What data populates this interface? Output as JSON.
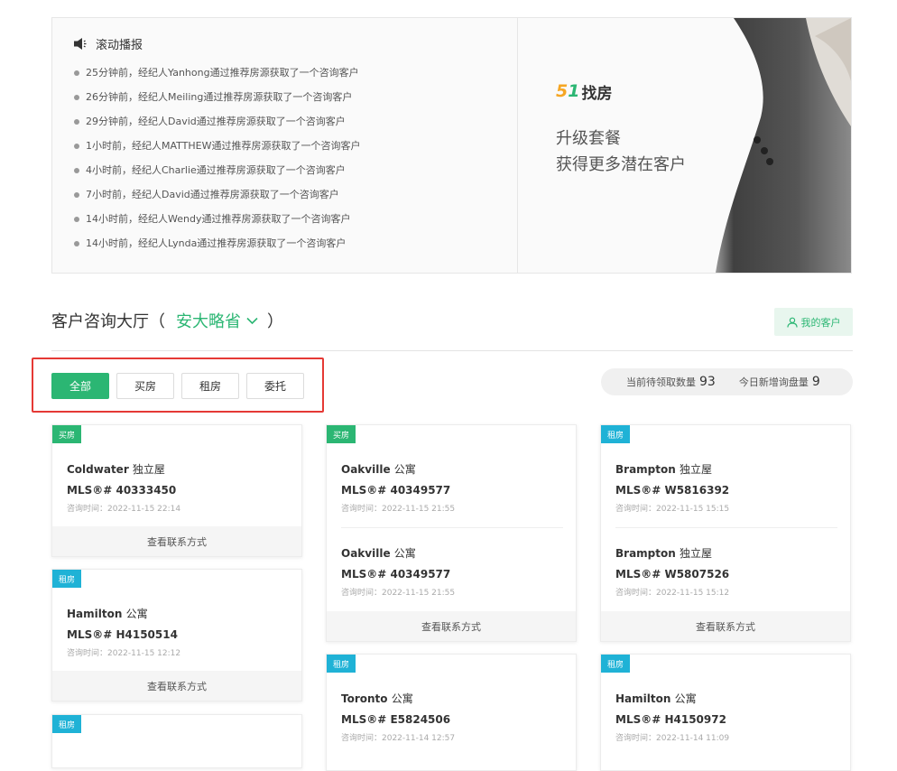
{
  "broadcast": {
    "title": "滚动播报",
    "items": [
      "25分钟前，经纪人Yanhong通过推荐房源获取了一个咨询客户",
      "26分钟前，经纪人Meiling通过推荐房源获取了一个咨询客户",
      "29分钟前，经纪人David通过推荐房源获取了一个咨询客户",
      "1小时前，经纪人MATTHEW通过推荐房源获取了一个咨询客户",
      "4小时前，经纪人Charlie通过推荐房源获取了一个咨询客户",
      "7小时前，经纪人David通过推荐房源获取了一个咨询客户",
      "14小时前，经纪人Wendy通过推荐房源获取了一个咨询客户",
      "14小时前，经纪人Lynda通过推荐房源获取了一个咨询客户"
    ]
  },
  "promo": {
    "logo_num5": "5",
    "logo_num1": "1",
    "logo_text": "找房",
    "line1": "升级套餐",
    "line2": "获得更多潜在客户"
  },
  "hall": {
    "title": "客户咨询大厅",
    "paren_left": "（",
    "region": "安大略省",
    "paren_right": "）",
    "my_customers": "我的客户"
  },
  "filters": {
    "all": "全部",
    "buy": "买房",
    "rent": "租房",
    "consign": "委托"
  },
  "stats": {
    "pending_label": "当前待领取数量",
    "pending_value": "93",
    "today_label": "今日新增询盘量",
    "today_value": "9"
  },
  "cards": [
    {
      "tag": "买房",
      "entries": [
        {
          "city": "Coldwater",
          "ptype": "独立屋",
          "mls": "MLS®# 40333450",
          "time": "咨询时间：2022-11-15 22:14"
        }
      ],
      "contact": "查看联系方式"
    },
    {
      "tag": "租房",
      "entries": [
        {
          "city": "Hamilton",
          "ptype": "公寓",
          "mls": "MLS®# H4150514",
          "time": "咨询时间：2022-11-15 12:12"
        }
      ],
      "contact": "查看联系方式"
    },
    {
      "tag": "租房"
    },
    {
      "tag": "买房",
      "entries": [
        {
          "city": "Oakville",
          "ptype": "公寓",
          "mls": "MLS®# 40349577",
          "time": "咨询时间：2022-11-15 21:55"
        },
        {
          "city": "Oakville",
          "ptype": "公寓",
          "mls": "MLS®# 40349577",
          "time": "咨询时间：2022-11-15 21:55"
        }
      ],
      "contact": "查看联系方式"
    },
    {
      "tag": "租房",
      "entries": [
        {
          "city": "Toronto",
          "ptype": "公寓",
          "mls": "MLS®# E5824506",
          "time": "咨询时间：2022-11-14 12:57"
        }
      ]
    },
    {
      "tag": "租房",
      "entries": [
        {
          "city": "Brampton",
          "ptype": "独立屋",
          "mls": "MLS®# W5816392",
          "time": "咨询时间：2022-11-15 15:15"
        },
        {
          "city": "Brampton",
          "ptype": "独立屋",
          "mls": "MLS®# W5807526",
          "time": "咨询时间：2022-11-15 15:12"
        }
      ],
      "contact": "查看联系方式"
    },
    {
      "tag": "租房",
      "entries": [
        {
          "city": "Hamilton",
          "ptype": "公寓",
          "mls": "MLS®# H4150972",
          "time": "咨询时间：2022-11-14 11:09"
        }
      ]
    }
  ],
  "colors": {
    "accent_green": "#2bb673",
    "rent_blue": "#1fb2d6",
    "highlight_red": "#e53935"
  },
  "icons": [
    "speaker-icon",
    "chevron-down-icon",
    "person-icon"
  ]
}
